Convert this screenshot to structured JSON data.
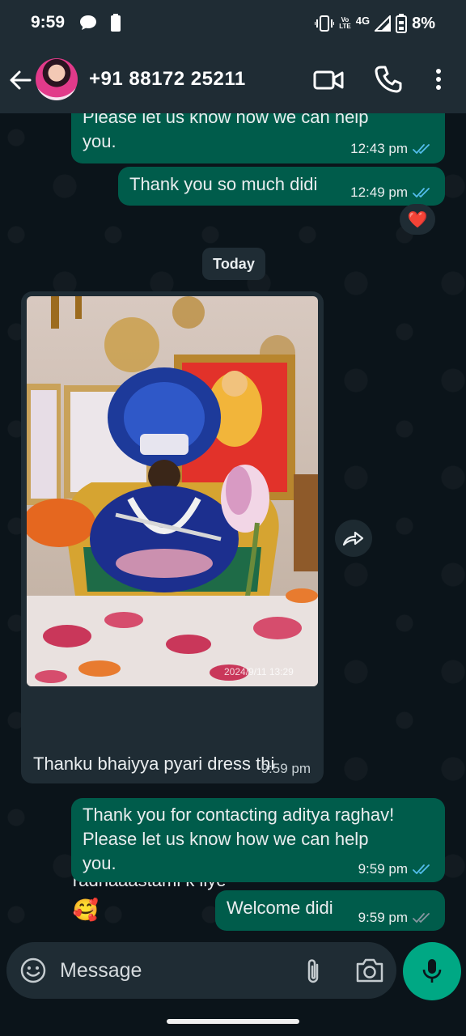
{
  "status_bar": {
    "time": "9:59",
    "network": "4G",
    "volte_top": "Vo",
    "volte_bottom": "LTE",
    "battery": "8%"
  },
  "header": {
    "contact_name": "+91 88172 25211"
  },
  "chat": {
    "messages": [
      {
        "direction": "outgoing",
        "text": "Please let us know how we can help\nyou.",
        "time": "12:43 pm",
        "status": "read"
      },
      {
        "direction": "outgoing",
        "text": "Thank you so much didi",
        "time": "12:49 pm",
        "status": "read",
        "reaction": "❤️"
      },
      {
        "direction": "incoming",
        "type": "image",
        "image_stamp": "2024/9/11  13:29",
        "caption_line1": "Thanku bhaiyya pyari dress thi",
        "caption_line2": "radhaaastami k liye",
        "caption_emoji": "🥰",
        "time": "9:59 pm"
      },
      {
        "direction": "outgoing",
        "text": "Thank you for contacting aditya raghav!\nPlease let us know how we can help\nyou.",
        "time": "9:59 pm",
        "status": "read"
      },
      {
        "direction": "outgoing",
        "text": "Welcome didi",
        "time": "9:59 pm",
        "status": "read"
      }
    ],
    "date_separator": "Today"
  },
  "composer": {
    "placeholder": "Message"
  },
  "colors": {
    "outgoing_bubble": "#005c4b",
    "incoming_bubble": "#1f2c34",
    "background": "#0b141a",
    "accent": "#00a884",
    "read_ticks": "#53bdeb"
  },
  "icons": [
    "back-arrow-icon",
    "video-call-icon",
    "phone-icon",
    "more-vert-icon",
    "emoji-icon",
    "attach-icon",
    "camera-icon",
    "mic-icon",
    "forward-icon",
    "read-ticks-icon"
  ]
}
